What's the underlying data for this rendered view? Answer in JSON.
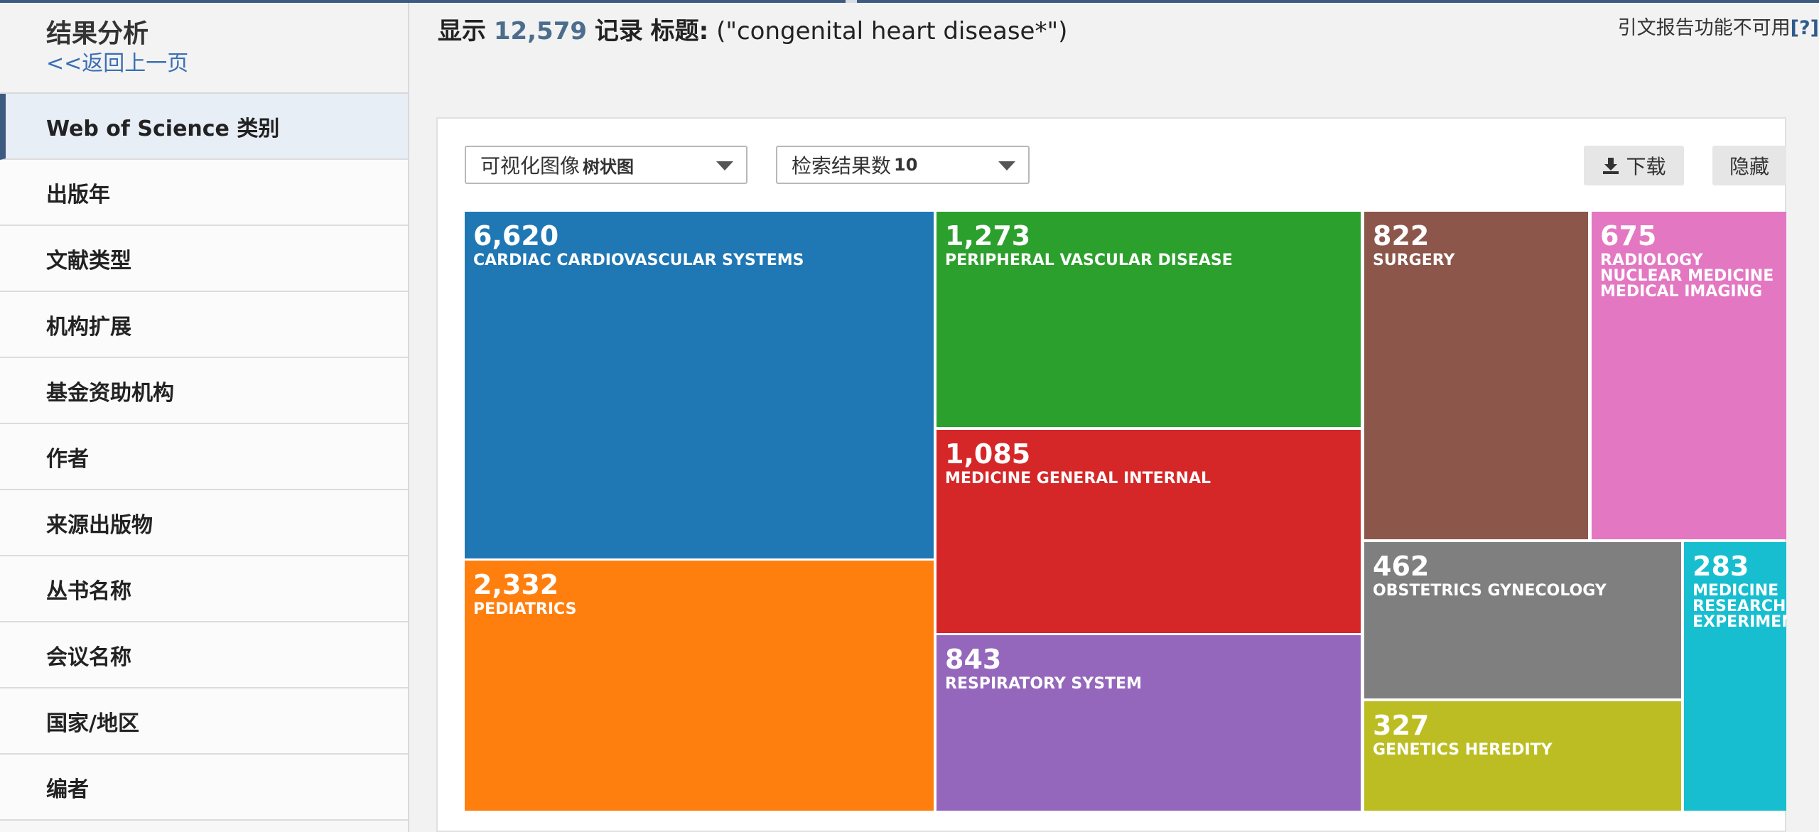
{
  "sidebar": {
    "title": "结果分析",
    "back_link": "<<返回上一页",
    "items": [
      {
        "label": "Web of Science 类别",
        "active": true
      },
      {
        "label": "出版年"
      },
      {
        "label": "文献类型"
      },
      {
        "label": "机构扩展"
      },
      {
        "label": "基金资助机构"
      },
      {
        "label": "作者"
      },
      {
        "label": "来源出版物"
      },
      {
        "label": "丛书名称"
      },
      {
        "label": "会议名称"
      },
      {
        "label": "国家/地区"
      },
      {
        "label": "编者"
      }
    ]
  },
  "header": {
    "prefix": "显示",
    "record_count": "12,579",
    "records_word": "记录",
    "query_label": "标题:",
    "query": "(\"congenital heart disease*\")",
    "cite_report_note": "引文报告功能不可用",
    "help_link": "[?]"
  },
  "controls": {
    "visualization_label": "可视化图像",
    "visualization_value": "树状图",
    "results_count_label": "检索结果数",
    "results_count_value": "10",
    "download_label": "下载",
    "hide_label": "隐藏"
  },
  "chart_data": {
    "type": "treemap",
    "title": "",
    "items": [
      {
        "name": "CARDIAC CARDIOVASCULAR SYSTEMS",
        "value": 6620,
        "display": "6,620",
        "color": "#1f77b4"
      },
      {
        "name": "PEDIATRICS",
        "value": 2332,
        "display": "2,332",
        "color": "#ff7f0e"
      },
      {
        "name": "PERIPHERAL VASCULAR DISEASE",
        "value": 1273,
        "display": "1,273",
        "color": "#2ca02c"
      },
      {
        "name": "MEDICINE GENERAL INTERNAL",
        "value": 1085,
        "display": "1,085",
        "color": "#d62728"
      },
      {
        "name": "RESPIRATORY SYSTEM",
        "value": 843,
        "display": "843",
        "color": "#9467bd"
      },
      {
        "name": "SURGERY",
        "value": 822,
        "display": "822",
        "color": "#8c564b"
      },
      {
        "name": "RADIOLOGY NUCLEAR MEDICINE MEDICAL IMAGING",
        "value": 675,
        "display": "675",
        "color": "#e377c2"
      },
      {
        "name": "OBSTETRICS GYNECOLOGY",
        "value": 462,
        "display": "462",
        "color": "#7f7f7f"
      },
      {
        "name": "GENETICS HEREDITY",
        "value": 327,
        "display": "327",
        "color": "#bcbd22"
      },
      {
        "name": "MEDICINE RESEARCH EXPERIMENTAL",
        "value": 283,
        "display": "283",
        "color": "#17becf"
      }
    ]
  }
}
